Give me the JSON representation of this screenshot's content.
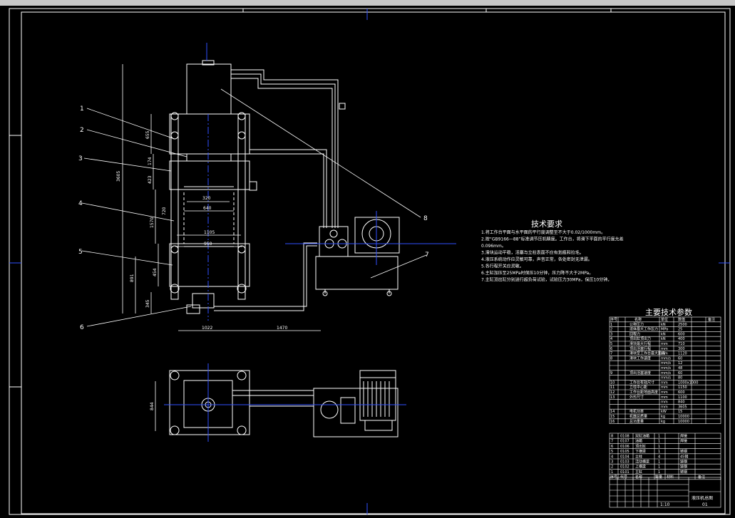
{
  "colors": {
    "background": "#000000",
    "line": "#ffffff",
    "accent_blue": "#3050ff",
    "titlebar": "#c8c8c8"
  },
  "drawing": {
    "leaders": [
      "1",
      "2",
      "3",
      "4",
      "5",
      "6",
      "7",
      "8"
    ],
    "dims": {
      "total_height": "3605",
      "d1": "655",
      "d2": "174",
      "d3": "423",
      "d4": "1570",
      "d5": "720",
      "d6": "454",
      "d7": "891",
      "d8": "345",
      "w1": "320",
      "w2": "640",
      "w3": "1105",
      "w4": "950",
      "w5": "1022",
      "w6": "1470",
      "plan_h": "844"
    }
  },
  "tech": {
    "heading": "技术要求",
    "lines": [
      "1.将工作台平面与水平面的平行度调整至不大于0.02/1000mm。",
      "2.按“GB9166—88”标准调节压机精度。工作台，将滑下平面的平行度允差",
      "  0.096mm。",
      "3.滑块运动平稳，活塞与立柱表面不应有划痕和拉毛。",
      "4.液压系统动作应灵敏可靠，声音正常，各处密封无泄漏。",
      "5.各行程开关应灵敏。",
      "6.主缸加压至25MPa时保压10分钟，压力降不大于2MPa。",
      "7.主缸顶出缸分别进行超负荷试验，试验压力30MPa，保压10分钟。"
    ]
  },
  "params": {
    "heading": "主要技术参数",
    "header": [
      "序号",
      "",
      "名称",
      "单位",
      "数值",
      "备注"
    ],
    "rows": [
      [
        "1",
        "公称压力",
        "kN",
        "2500"
      ],
      [
        "2",
        "液体最大工作压力",
        "MPa",
        "25"
      ],
      [
        "3",
        "回程力",
        "kN",
        "600"
      ],
      [
        "4",
        "顶出缸顶出力",
        "kN",
        "400"
      ],
      [
        "5",
        "滑块最大行程",
        "mm",
        "710"
      ],
      [
        "6",
        "顶出活塞行程",
        "mm",
        "300"
      ],
      [
        "7",
        "滑块至工作台最大距离",
        "mm",
        "1120"
      ],
      [
        "8",
        "滑块工作速度",
        "mm/s",
        "60"
      ],
      [
        "",
        "",
        "mm/s",
        "12"
      ],
      [
        "",
        "",
        "mm/s",
        "48"
      ],
      [
        "9",
        "顶出活塞速度",
        "mm/s",
        "60"
      ],
      [
        "",
        "",
        "mm/s",
        "80"
      ],
      [
        "10",
        "工作台有效尺寸",
        "mm",
        "1000x1000"
      ],
      [
        "11",
        "立柱中心距",
        "mm",
        "1150"
      ],
      [
        "12",
        "工作台距地面高度",
        "mm",
        "600"
      ],
      [
        "13",
        "外形尺寸",
        "mm",
        "1100"
      ],
      [
        "",
        "",
        "mm",
        "840"
      ],
      [
        "",
        "",
        "mm",
        "3605"
      ],
      [
        "14",
        "电机功率",
        "kW",
        "15"
      ],
      [
        "15",
        "机器总质量",
        "kg",
        "10000"
      ],
      [
        "16",
        "总功重量",
        "kg",
        "10000"
      ]
    ]
  },
  "parts": {
    "rows": [
      [
        "8",
        "0108",
        "双缸油箱",
        "1",
        "焊接"
      ],
      [
        "7",
        "0107",
        "油箱",
        "1",
        "焊接"
      ],
      [
        "6",
        "0106",
        "顶出缸",
        "1",
        ""
      ],
      [
        "5",
        "0105",
        "下横梁",
        "1",
        "铸钢"
      ],
      [
        "4",
        "0104",
        "立柱",
        "4",
        "45钢"
      ],
      [
        "3",
        "0103",
        "活动横梁",
        "1",
        "铸钢"
      ],
      [
        "2",
        "0102",
        "上横梁",
        "1",
        "铸钢"
      ],
      [
        "1",
        "0101",
        "主缸",
        "1",
        "铸钢"
      ]
    ],
    "header": [
      "序号",
      "代号",
      "名称",
      "数量",
      "材料",
      "备注"
    ]
  },
  "title_block": {
    "name": "液压机总图",
    "number": "01",
    "scale": "1:10"
  }
}
